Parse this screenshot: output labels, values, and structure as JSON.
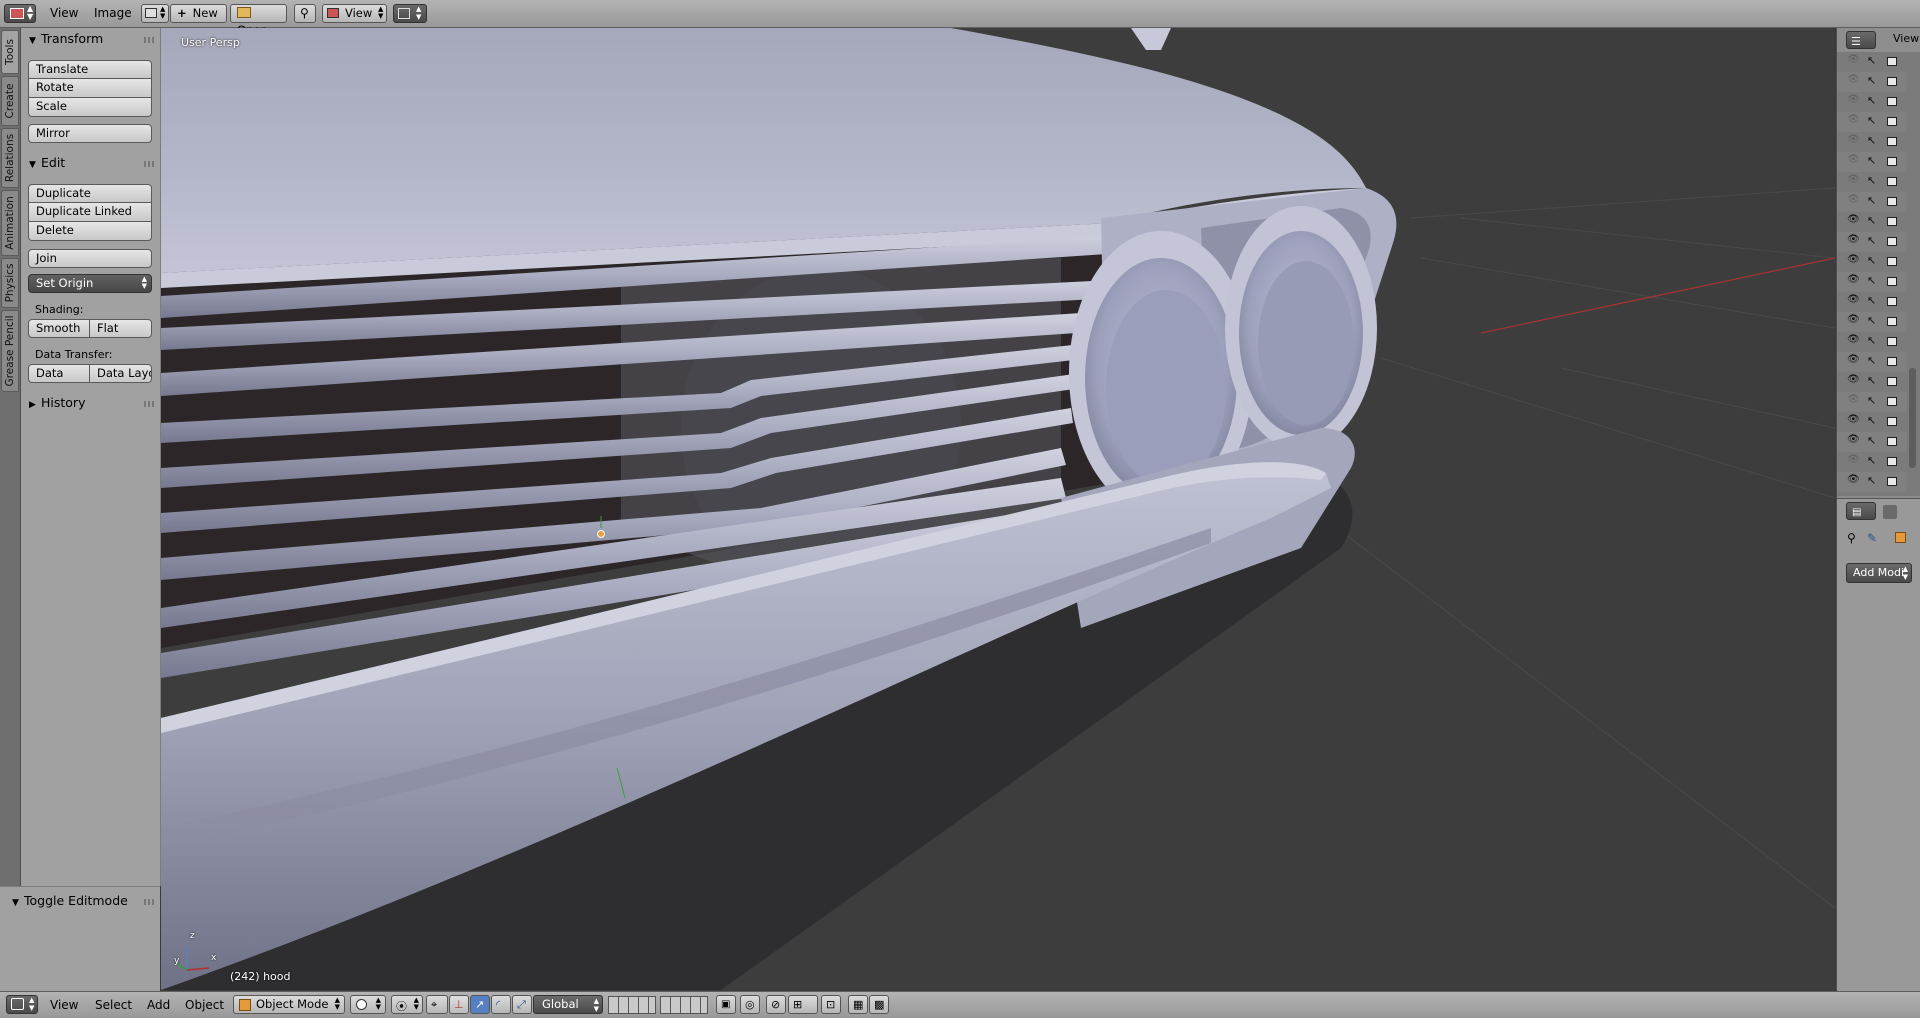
{
  "top_header": {
    "menus": [
      "View",
      "Image"
    ],
    "new_label": "New",
    "open_label": "Open",
    "view_dropdown": "View"
  },
  "left_tabs": [
    "Tools",
    "Create",
    "Relations",
    "Animation",
    "Physics",
    "Grease Pencil"
  ],
  "tool_shelf": {
    "transform": {
      "title": "Transform",
      "buttons": [
        "Translate",
        "Rotate",
        "Scale",
        "Mirror"
      ]
    },
    "edit": {
      "title": "Edit",
      "buttons": [
        "Duplicate",
        "Duplicate Linked",
        "Delete",
        "Join"
      ],
      "set_origin": "Set Origin",
      "shading_label": "Shading:",
      "shading_buttons": [
        "Smooth",
        "Flat"
      ],
      "data_transfer_label": "Data Transfer:",
      "data_transfer_buttons": [
        "Data",
        "Data Layo"
      ]
    },
    "history": {
      "title": "History"
    },
    "toggle_editmode": {
      "title": "Toggle Editmode"
    }
  },
  "viewport": {
    "view_label": "User Persp",
    "object_info": "(242) hood",
    "axis_labels": {
      "x": "x",
      "y": "y",
      "z": "z"
    }
  },
  "outliner": {
    "header_label": "View",
    "row_count": 22,
    "visible_rows": [
      false,
      false,
      false,
      false,
      false,
      false,
      false,
      false,
      true,
      true,
      true,
      true,
      true,
      true,
      true,
      true,
      true,
      false,
      true,
      true,
      false,
      true
    ]
  },
  "properties": {
    "add_modifier_label": "Add Modi"
  },
  "bottom_header": {
    "menus": [
      "View",
      "Select",
      "Add",
      "Object"
    ],
    "mode": "Object Mode",
    "orientation": "Global"
  },
  "colors": {
    "header_bg": "#a6a6a6",
    "panel_bg": "#a1a1a1",
    "viewport_bg": "#3d3d3d",
    "mesh_color": "#b4b6cc",
    "red_axis": "#b03030",
    "green_axis": "#3f9c3f",
    "accent_blue": "#5680c2"
  }
}
